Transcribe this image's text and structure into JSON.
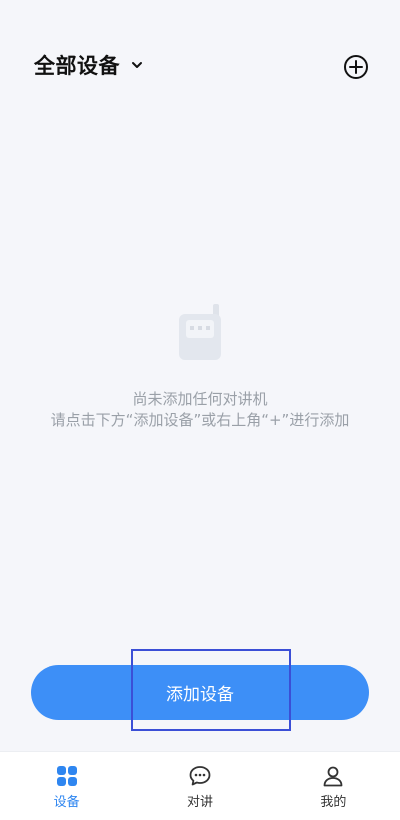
{
  "header": {
    "title": "全部设备",
    "dropdown_icon": "chevron-down-icon",
    "add_icon": "plus-circle-icon"
  },
  "empty_state": {
    "icon": "walkie-talkie-icon",
    "title": "尚未添加任何对讲机",
    "description": "请点击下方“添加设备”或右上角“+”进行添加"
  },
  "primary_button": {
    "label": "添加设备",
    "color": "#3d8ff7"
  },
  "tabbar": {
    "tabs": [
      {
        "label": "设备",
        "icon": "devices-grid-icon",
        "active": true
      },
      {
        "label": "对讲",
        "icon": "chat-bubble-icon",
        "active": false
      },
      {
        "label": "我的",
        "icon": "user-icon",
        "active": false
      }
    ],
    "active_color": "#2f86f0"
  }
}
